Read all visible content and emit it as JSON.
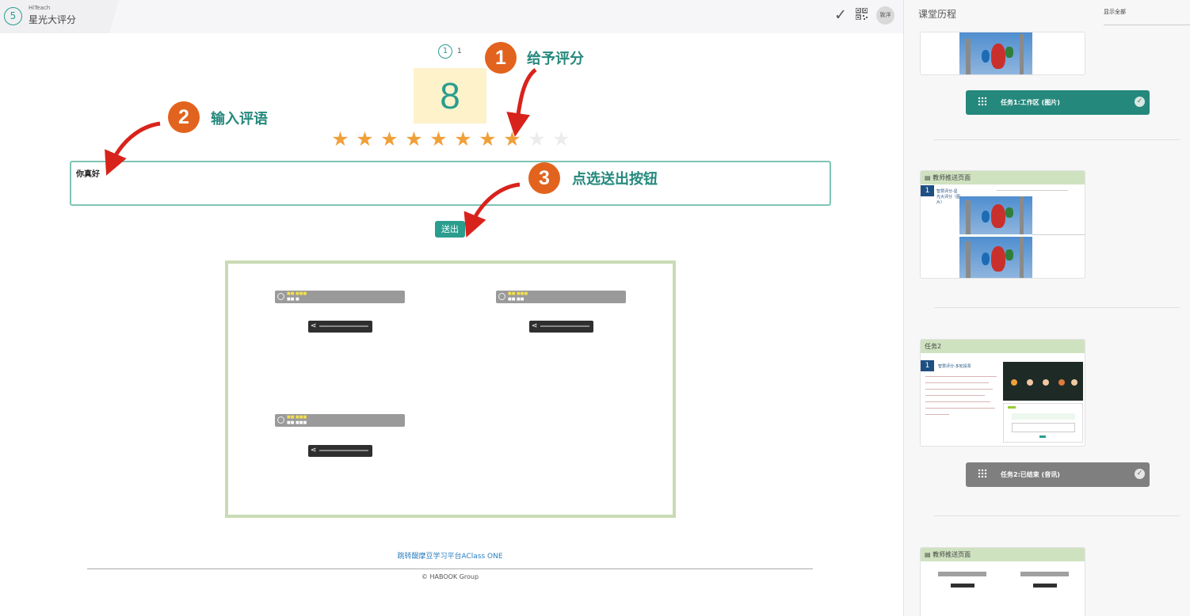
{
  "app": {
    "brand_sub": "HiTeach",
    "brand_title": "星光大评分",
    "brand_step": "5",
    "avatar_label": "致洋"
  },
  "rating": {
    "question_index": "1",
    "question_count": "1",
    "score": "8",
    "max_stars": 10,
    "filled_stars": 8,
    "comment": "你真好",
    "send_label": "送出"
  },
  "callouts": [
    {
      "num": "1",
      "text": "给予评分"
    },
    {
      "num": "2",
      "text": "输入评语"
    },
    {
      "num": "3",
      "text": "点选送出按钮"
    }
  ],
  "footer": {
    "link": "跳转醍摩豆学习平台AClass ONE",
    "copyright": "© HABOOK Group"
  },
  "sidebar": {
    "title": "课堂历程",
    "show_all": "显示全部",
    "task1": "任务1:工作区 (图片)",
    "card1_header": "教师推送页面",
    "card1_slide_title": "智慧评分-星光大评分（图片）",
    "card2_header": "任务2",
    "card2_slide_title": "智慧评分-多轮投票",
    "task2": "任务2:已结束 (音讯)",
    "card3_header": "教师推送页面"
  },
  "colors": {
    "accent": "#2a9d8f",
    "callout": "#e2631e",
    "star_on": "#f0a03a",
    "task_done": "#7f7f7f"
  }
}
